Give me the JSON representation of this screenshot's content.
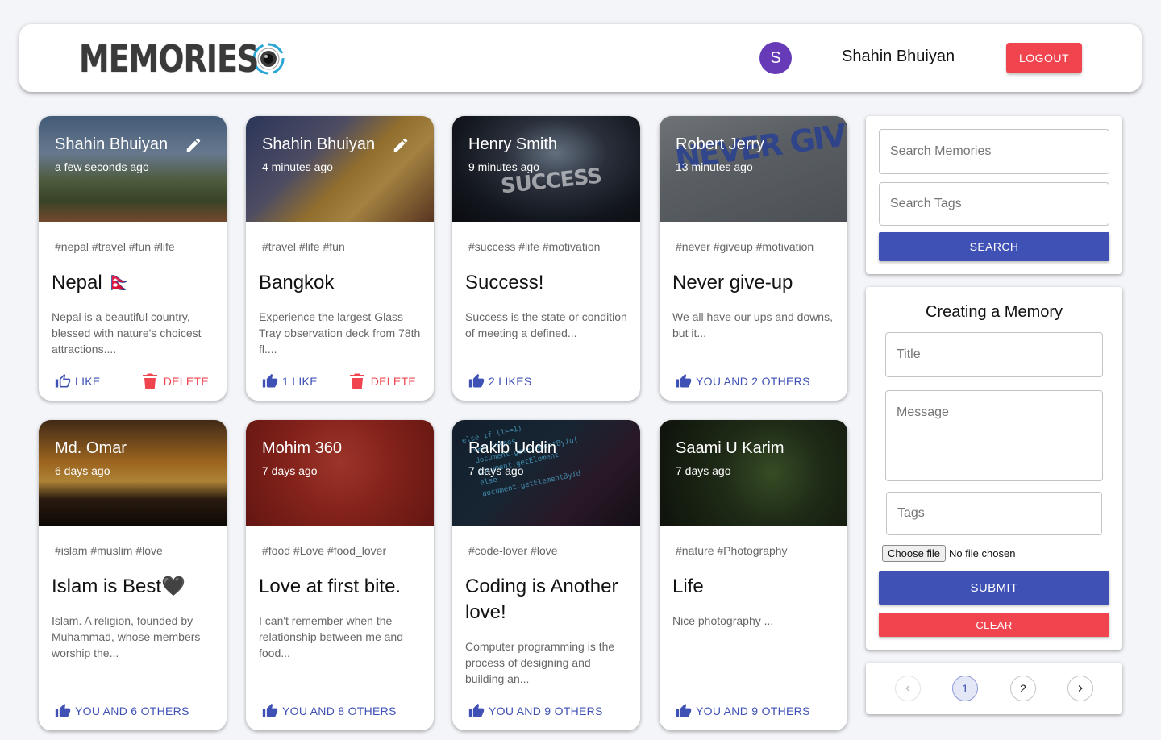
{
  "header": {
    "brand": "MEMORIES",
    "avatar_letter": "S",
    "username": "Shahin Bhuiyan",
    "logout_label": "LOGOUT"
  },
  "colors": {
    "primary": "#3f51b5",
    "secondary": "#f0444f",
    "avatar": "#673ab7",
    "background": "#f4f5f9"
  },
  "delete_label": "DELETE",
  "posts": [
    {
      "author": "Shahin Bhuiyan",
      "time": "a few seconds ago",
      "tags": "#nepal #travel #fun #life",
      "title": "Nepal 🇳🇵",
      "message": "Nepal is a beautiful country, blessed with nature's choicest attractions....",
      "likes": "LIKE",
      "like_style": "outline",
      "editable": true,
      "deletable": true
    },
    {
      "author": "Shahin Bhuiyan",
      "time": "4 minutes ago",
      "tags": "#travel #life #fun",
      "title": "Bangkok",
      "message": "Experience the largest Glass Tray observation deck from 78th fl....",
      "likes": "1 LIKE",
      "like_style": "filled",
      "editable": true,
      "deletable": true
    },
    {
      "author": "Henry Smith",
      "time": "9 minutes ago",
      "tags": "#success #life #motivation",
      "title": "Success!",
      "message": "Success is the state or condition of meeting a defined...",
      "likes": "2 LIKES",
      "like_style": "filled",
      "editable": false,
      "deletable": false
    },
    {
      "author": "Robert Jerry",
      "time": "13 minutes ago",
      "tags": "#never #giveup #motivation",
      "title": "Never give-up",
      "message": "We all have our ups and downs, but it...",
      "likes": "YOU AND 2 OTHERS",
      "like_style": "filled",
      "editable": false,
      "deletable": false
    },
    {
      "author": "Md. Omar",
      "time": "6 days ago",
      "tags": "#islam #muslim #love",
      "title": "Islam is Best🖤",
      "message": "Islam. A religion, founded by Muhammad, whose members worship the...",
      "likes": "YOU AND 6 OTHERS",
      "like_style": "filled",
      "editable": false,
      "deletable": false
    },
    {
      "author": "Mohim 360",
      "time": "7 days ago",
      "tags": "#food #Love #food_lover",
      "title": "Love at first bite.",
      "message": "I can't remember when the relationship between me and food...",
      "likes": "YOU AND 8 OTHERS",
      "like_style": "filled",
      "editable": false,
      "deletable": false
    },
    {
      "author": "Rakib Uddin",
      "time": "7 days ago",
      "tags": "#code-lover #love",
      "title": "Coding is Another love!",
      "message": "Computer programming is the process of designing and building an...",
      "likes": "YOU AND 9 OTHERS",
      "like_style": "filled",
      "editable": false,
      "deletable": false
    },
    {
      "author": "Saami U Karim",
      "time": "7 days ago",
      "tags": "#nature #Photography",
      "title": "Life",
      "message": "Nice photography ...",
      "likes": "YOU AND 9 OTHERS",
      "like_style": "filled",
      "editable": false,
      "deletable": false
    }
  ],
  "image_text": {
    "success": "SUCCESS",
    "giveup": "NEVER GIVE UP",
    "code": "else if (i==1)\n  var dotpos\n  document.getElementById(\n  document.getElement\n  else\n  document.getElementById"
  },
  "search": {
    "memories_placeholder": "Search Memories",
    "tags_placeholder": "Search Tags",
    "button_label": "SEARCH"
  },
  "form": {
    "title": "Creating a Memory",
    "title_placeholder": "Title",
    "message_placeholder": "Message",
    "tags_placeholder": "Tags",
    "file_button": "Choose file",
    "file_status": "No file chosen",
    "submit_label": "SUBMIT",
    "clear_label": "CLEAR"
  },
  "pagination": {
    "prev": "‹",
    "pages": [
      "1",
      "2"
    ],
    "next": "›",
    "current": "1"
  }
}
